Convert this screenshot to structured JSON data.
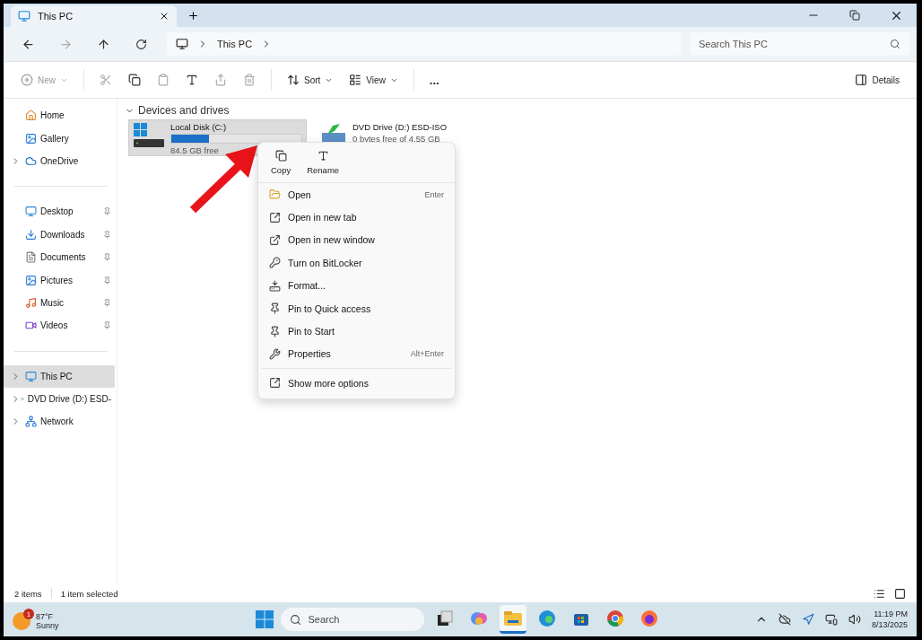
{
  "tab": {
    "title": "This PC",
    "selected": true
  },
  "address": {
    "crumbs": [
      "This PC"
    ],
    "search_placeholder": "Search This PC"
  },
  "commands": [
    {
      "kind": "menu",
      "label": "New",
      "disabled": true
    },
    {
      "kind": "icon",
      "disabled": true
    },
    {
      "kind": "icon",
      "disabled": false
    },
    {
      "kind": "icon",
      "disabled": true
    },
    {
      "kind": "icon",
      "disabled": false
    },
    {
      "kind": "icon",
      "disabled": true
    },
    {
      "kind": "icon",
      "disabled": true
    },
    {
      "kind": "menu",
      "label": "Sort",
      "disabled": false
    },
    {
      "kind": "menu",
      "label": "View",
      "disabled": false
    },
    {
      "kind": "more",
      "label": "...",
      "disabled": false
    }
  ],
  "details_label": "Details",
  "sidebar": {
    "groups": [
      [
        {
          "label": "Home",
          "expandable": false,
          "pinned": false,
          "selected": false
        },
        {
          "label": "Gallery",
          "expandable": false,
          "pinned": false,
          "selected": false
        },
        {
          "label": "OneDrive",
          "expandable": true,
          "pinned": false,
          "selected": false
        }
      ],
      [
        {
          "label": "Desktop",
          "expandable": false,
          "pinned": true,
          "selected": false
        },
        {
          "label": "Downloads",
          "expandable": false,
          "pinned": true,
          "selected": false
        },
        {
          "label": "Documents",
          "expandable": false,
          "pinned": true,
          "selected": false
        },
        {
          "label": "Pictures",
          "expandable": false,
          "pinned": true,
          "selected": false
        },
        {
          "label": "Music",
          "expandable": false,
          "pinned": true,
          "selected": false
        },
        {
          "label": "Videos",
          "expandable": false,
          "pinned": true,
          "selected": false
        }
      ],
      [
        {
          "label": "This PC",
          "expandable": true,
          "pinned": false,
          "selected": true
        },
        {
          "label": "DVD Drive (D:) ESD-",
          "expandable": true,
          "pinned": false,
          "selected": false
        },
        {
          "label": "Network",
          "expandable": true,
          "pinned": false,
          "selected": false
        }
      ]
    ]
  },
  "section": {
    "title": "Devices and drives",
    "expanded": true,
    "drives": [
      {
        "kind": "disk",
        "name": "Local Disk (C:)",
        "free": "84.5 GB free",
        "level": 0.29,
        "selected": true
      },
      {
        "kind": "dvd",
        "name": "DVD Drive (D:) ESD-ISO",
        "free": "0 bytes free of 4.55 GB",
        "selected": false
      }
    ]
  },
  "context_menu": {
    "quick_actions": [
      "Copy",
      "Rename"
    ],
    "items": [
      {
        "label": "Open",
        "shortcut": "Enter"
      },
      {
        "label": "Open in new tab"
      },
      {
        "label": "Open in new window"
      },
      {
        "label": "Turn on BitLocker"
      },
      {
        "label": "Format..."
      },
      {
        "label": "Pin to Quick access"
      },
      {
        "label": "Pin to Start"
      },
      {
        "label": "Properties",
        "shortcut": "Alt+Enter"
      }
    ],
    "more": "Show more options"
  },
  "status_bar": [
    "2 items",
    "1 item selected"
  ],
  "taskbar": {
    "weather": {
      "temp": "87°F",
      "condition": "Sunny",
      "badge": "1"
    },
    "search_placeholder": "Search",
    "time": "11:19 PM",
    "date": "8/13/2025",
    "apps": [
      {
        "selected": false
      },
      {
        "selected": false
      },
      {
        "selected": true
      },
      {
        "selected": false
      },
      {
        "selected": false
      },
      {
        "selected": false
      },
      {
        "selected": false
      }
    ]
  }
}
